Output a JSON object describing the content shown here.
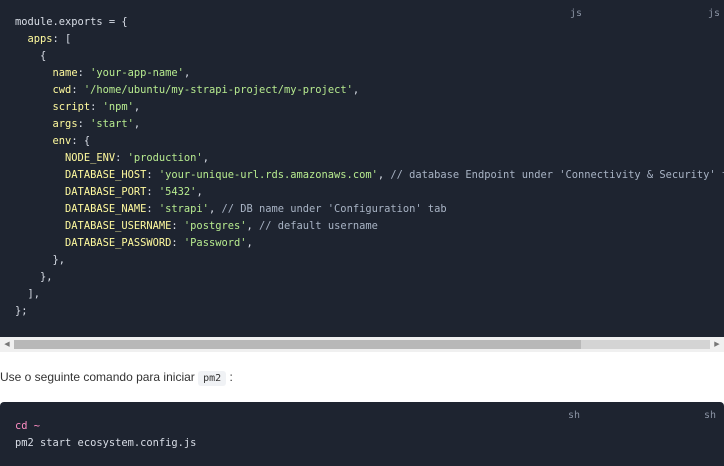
{
  "code_block_1": {
    "lang_labels": [
      "js",
      "js"
    ],
    "line_1": "module.exports = {",
    "line_2_key": "apps",
    "line_2_rest": ": [",
    "line_3": "{",
    "name_key": "name",
    "name_val": "'your-app-name'",
    "cwd_key": "cwd",
    "cwd_val": "'/home/ubuntu/my-strapi-project/my-project'",
    "script_key": "script",
    "script_val": "'npm'",
    "args_key": "args",
    "args_val": "'start'",
    "env_key": "env",
    "env_open": ": {",
    "node_env_key": "NODE_ENV",
    "node_env_val": "'production'",
    "db_host_key": "DATABASE_HOST",
    "db_host_val": "'your-unique-url.rds.amazonaws.com'",
    "db_host_comment": "// database Endpoint under 'Connectivity & Security' tab",
    "db_port_key": "DATABASE_PORT",
    "db_port_val": "'5432'",
    "db_name_key": "DATABASE_NAME",
    "db_name_val": "'strapi'",
    "db_name_comment": "// DB name under 'Configuration' tab",
    "db_user_key": "DATABASE_USERNAME",
    "db_user_val": "'postgres'",
    "db_user_comment": "// default username",
    "db_pass_key": "DATABASE_PASSWORD",
    "db_pass_val": "'Password'",
    "close_env": "},",
    "close_obj": "},",
    "close_arr": "],",
    "close_exports": "};"
  },
  "paragraph": {
    "text": "Use o seguinte comando para iniciar ",
    "code": "pm2",
    "suffix": " :"
  },
  "code_block_2": {
    "lang_labels": [
      "sh",
      "sh"
    ],
    "line_1": "cd ~",
    "line_2": "pm2 start ecosystem.config.js"
  },
  "scrollbar": {
    "left_arrow": "◀",
    "right_arrow": "▶"
  }
}
